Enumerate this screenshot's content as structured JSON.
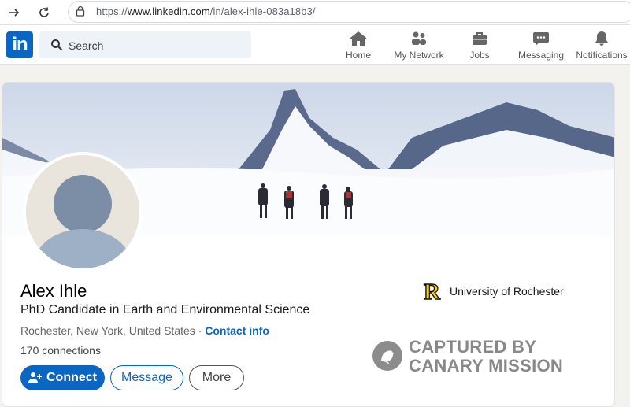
{
  "browser": {
    "url_prefix": "https://",
    "url_domain": "www.linkedin.com",
    "url_path": "/in/alex-ihle-083a18b3/"
  },
  "header": {
    "logo": "in",
    "search_placeholder": "Search",
    "nav": [
      {
        "label": "Home",
        "icon": "home-icon"
      },
      {
        "label": "My Network",
        "icon": "network-icon"
      },
      {
        "label": "Jobs",
        "icon": "briefcase-icon"
      },
      {
        "label": "Messaging",
        "icon": "chat-icon"
      },
      {
        "label": "Notifications",
        "icon": "bell-icon"
      }
    ]
  },
  "profile": {
    "name": "Alex Ihle",
    "headline": "PhD Candidate in Earth and Environmental Science",
    "location": "Rochester, New York, United States",
    "separator": " · ",
    "contact_label": "Contact info",
    "connections": "170 connections",
    "school_logo": "R",
    "school": "University of Rochester"
  },
  "actions": {
    "connect": "Connect",
    "message": "Message",
    "more": "More"
  },
  "watermark": {
    "line1": "CAPTURED BY",
    "line2": "CANARY MISSION"
  },
  "colors": {
    "brand": "#0a66c2",
    "school_yellow": "#ffd100"
  }
}
